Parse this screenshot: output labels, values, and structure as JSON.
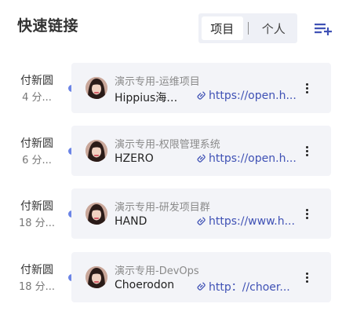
{
  "header": {
    "title": "快速链接",
    "tabs": [
      {
        "label": "项目",
        "active": true
      },
      {
        "label": "个人",
        "active": false
      }
    ],
    "add_icon": "add-list-icon"
  },
  "links": [
    {
      "user": "付新圆",
      "time": "4 分...",
      "project": "演示专用-运维项目",
      "name": "Hippius海马...",
      "url": "https://open.h..."
    },
    {
      "user": "付新圆",
      "time": "6 分...",
      "project": "演示专用-权限管理系统",
      "name": "HZERO",
      "url": "https://open.h..."
    },
    {
      "user": "付新圆",
      "time": "18 分...",
      "project": "演示专用-研发项目群",
      "name": "HAND",
      "url": "https://www.h..."
    },
    {
      "user": "付新圆",
      "time": "18 分...",
      "project": "演示专用-DevOps",
      "name": "Choerodon",
      "url": "http：//choer..."
    }
  ],
  "colors": {
    "accent": "#3f51b5",
    "dot": "#6b84e6",
    "card_bg": "#f3f4f8"
  }
}
